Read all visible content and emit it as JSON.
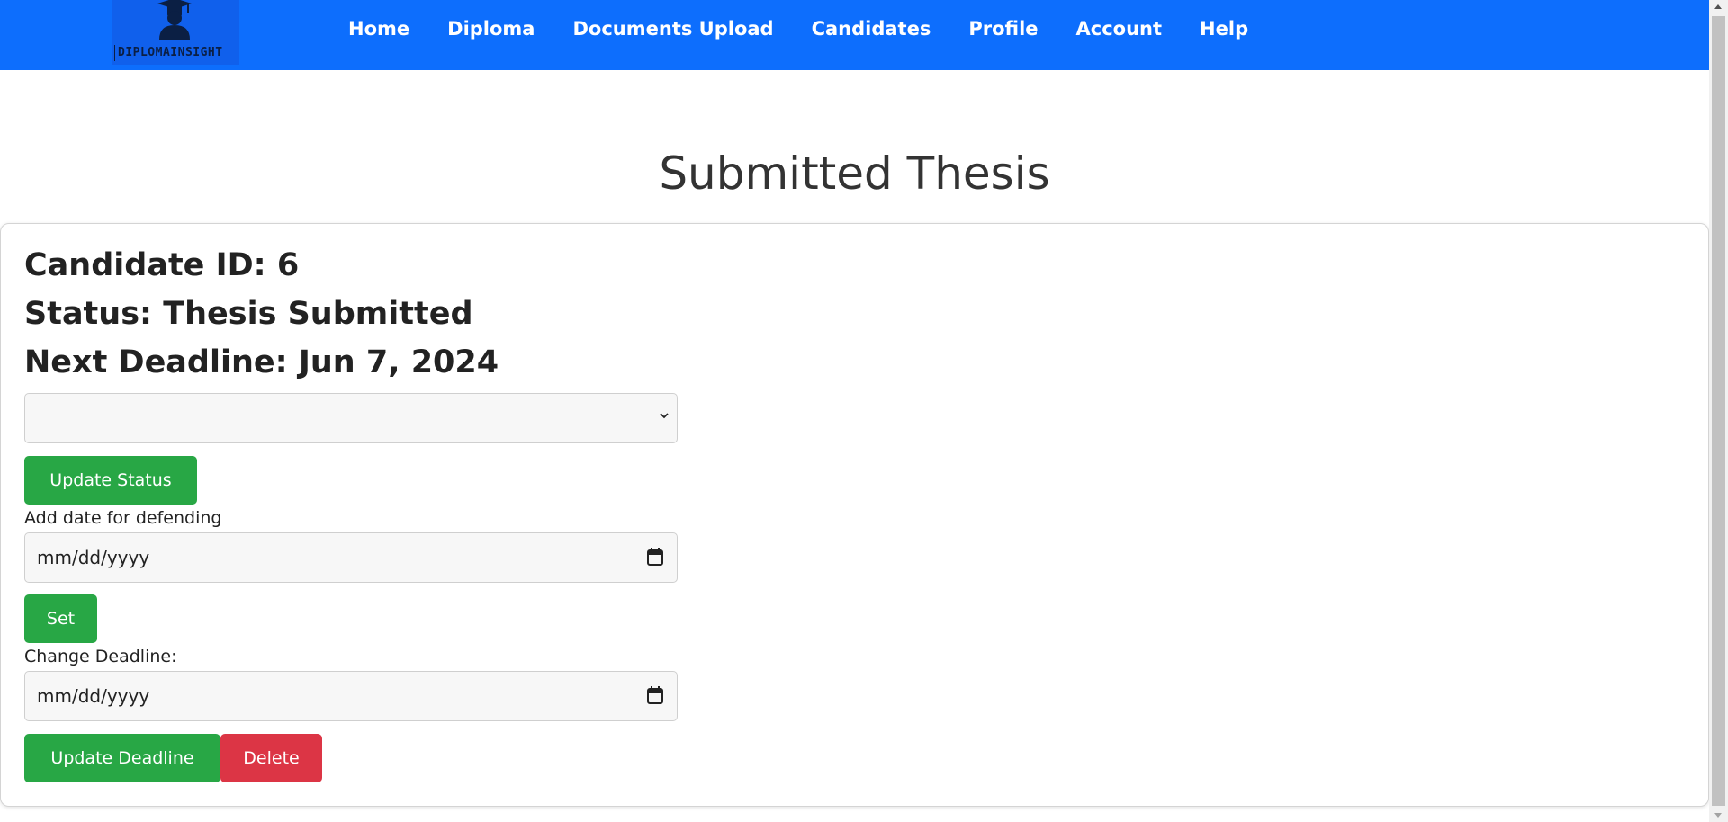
{
  "navbar": {
    "logo_text": "DIPLOMAINSIGHT",
    "logo_icon": "graduate-icon",
    "bg_color": "#0d6efd",
    "links": [
      "Home",
      "Diploma",
      "Documents Upload",
      "Candidates",
      "Profile",
      "Account",
      "Help"
    ]
  },
  "page_title": "Submitted Thesis",
  "candidate": {
    "id_text": "Candidate ID: 6",
    "status_text": "Status: Thesis Submitted",
    "deadline_text": "Next Deadline: Jun 7, 2024"
  },
  "status_select": {
    "selected_value": "",
    "icon": "chevron-down-icon"
  },
  "buttons": {
    "update_status": "Update Status",
    "set": "Set",
    "update_deadline": "Update Deadline",
    "delete": "Delete"
  },
  "defend_date": {
    "label": "Add date for defending",
    "placeholder": "mm/dd/yyyy",
    "icon": "calendar-icon"
  },
  "deadline_date": {
    "label": "Change Deadline:",
    "placeholder": "mm/dd/yyyy",
    "icon": "calendar-icon"
  },
  "colors": {
    "primary": "#0d6efd",
    "success": "#28a745",
    "danger": "#dc3545"
  }
}
